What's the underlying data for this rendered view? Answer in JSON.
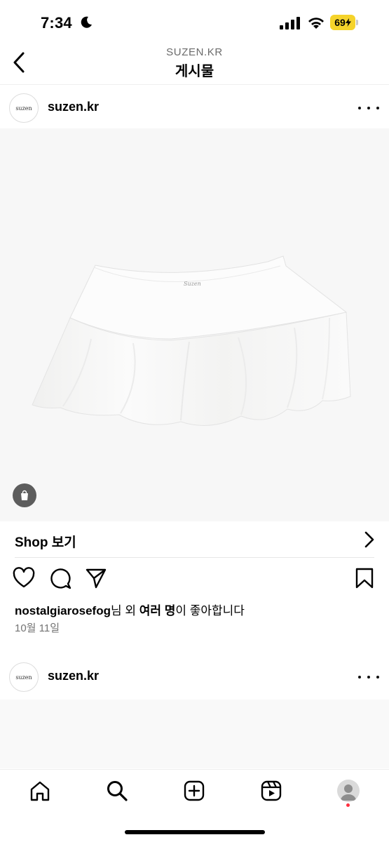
{
  "status_bar": {
    "time": "7:34",
    "battery": "69"
  },
  "header": {
    "account": "SUZEN.KR",
    "title": "게시물"
  },
  "posts": [
    {
      "avatar_text": "suzen",
      "username": "suzen.kr",
      "image_logo_text": "Suzen",
      "shop_label": "Shop 보기",
      "likes": {
        "name": "nostalgiarosefog",
        "middle": "님 외 ",
        "others": "여러 명",
        "suffix": "이 좋아합니다"
      },
      "date": "10월 11일"
    },
    {
      "avatar_text": "suzen",
      "username": "suzen.kr"
    }
  ],
  "tab_bar": {
    "tabs": [
      "home",
      "search",
      "create",
      "reels",
      "profile"
    ]
  },
  "colors": {
    "notification_dot": "#ff3040",
    "battery": "#f5d32b"
  }
}
